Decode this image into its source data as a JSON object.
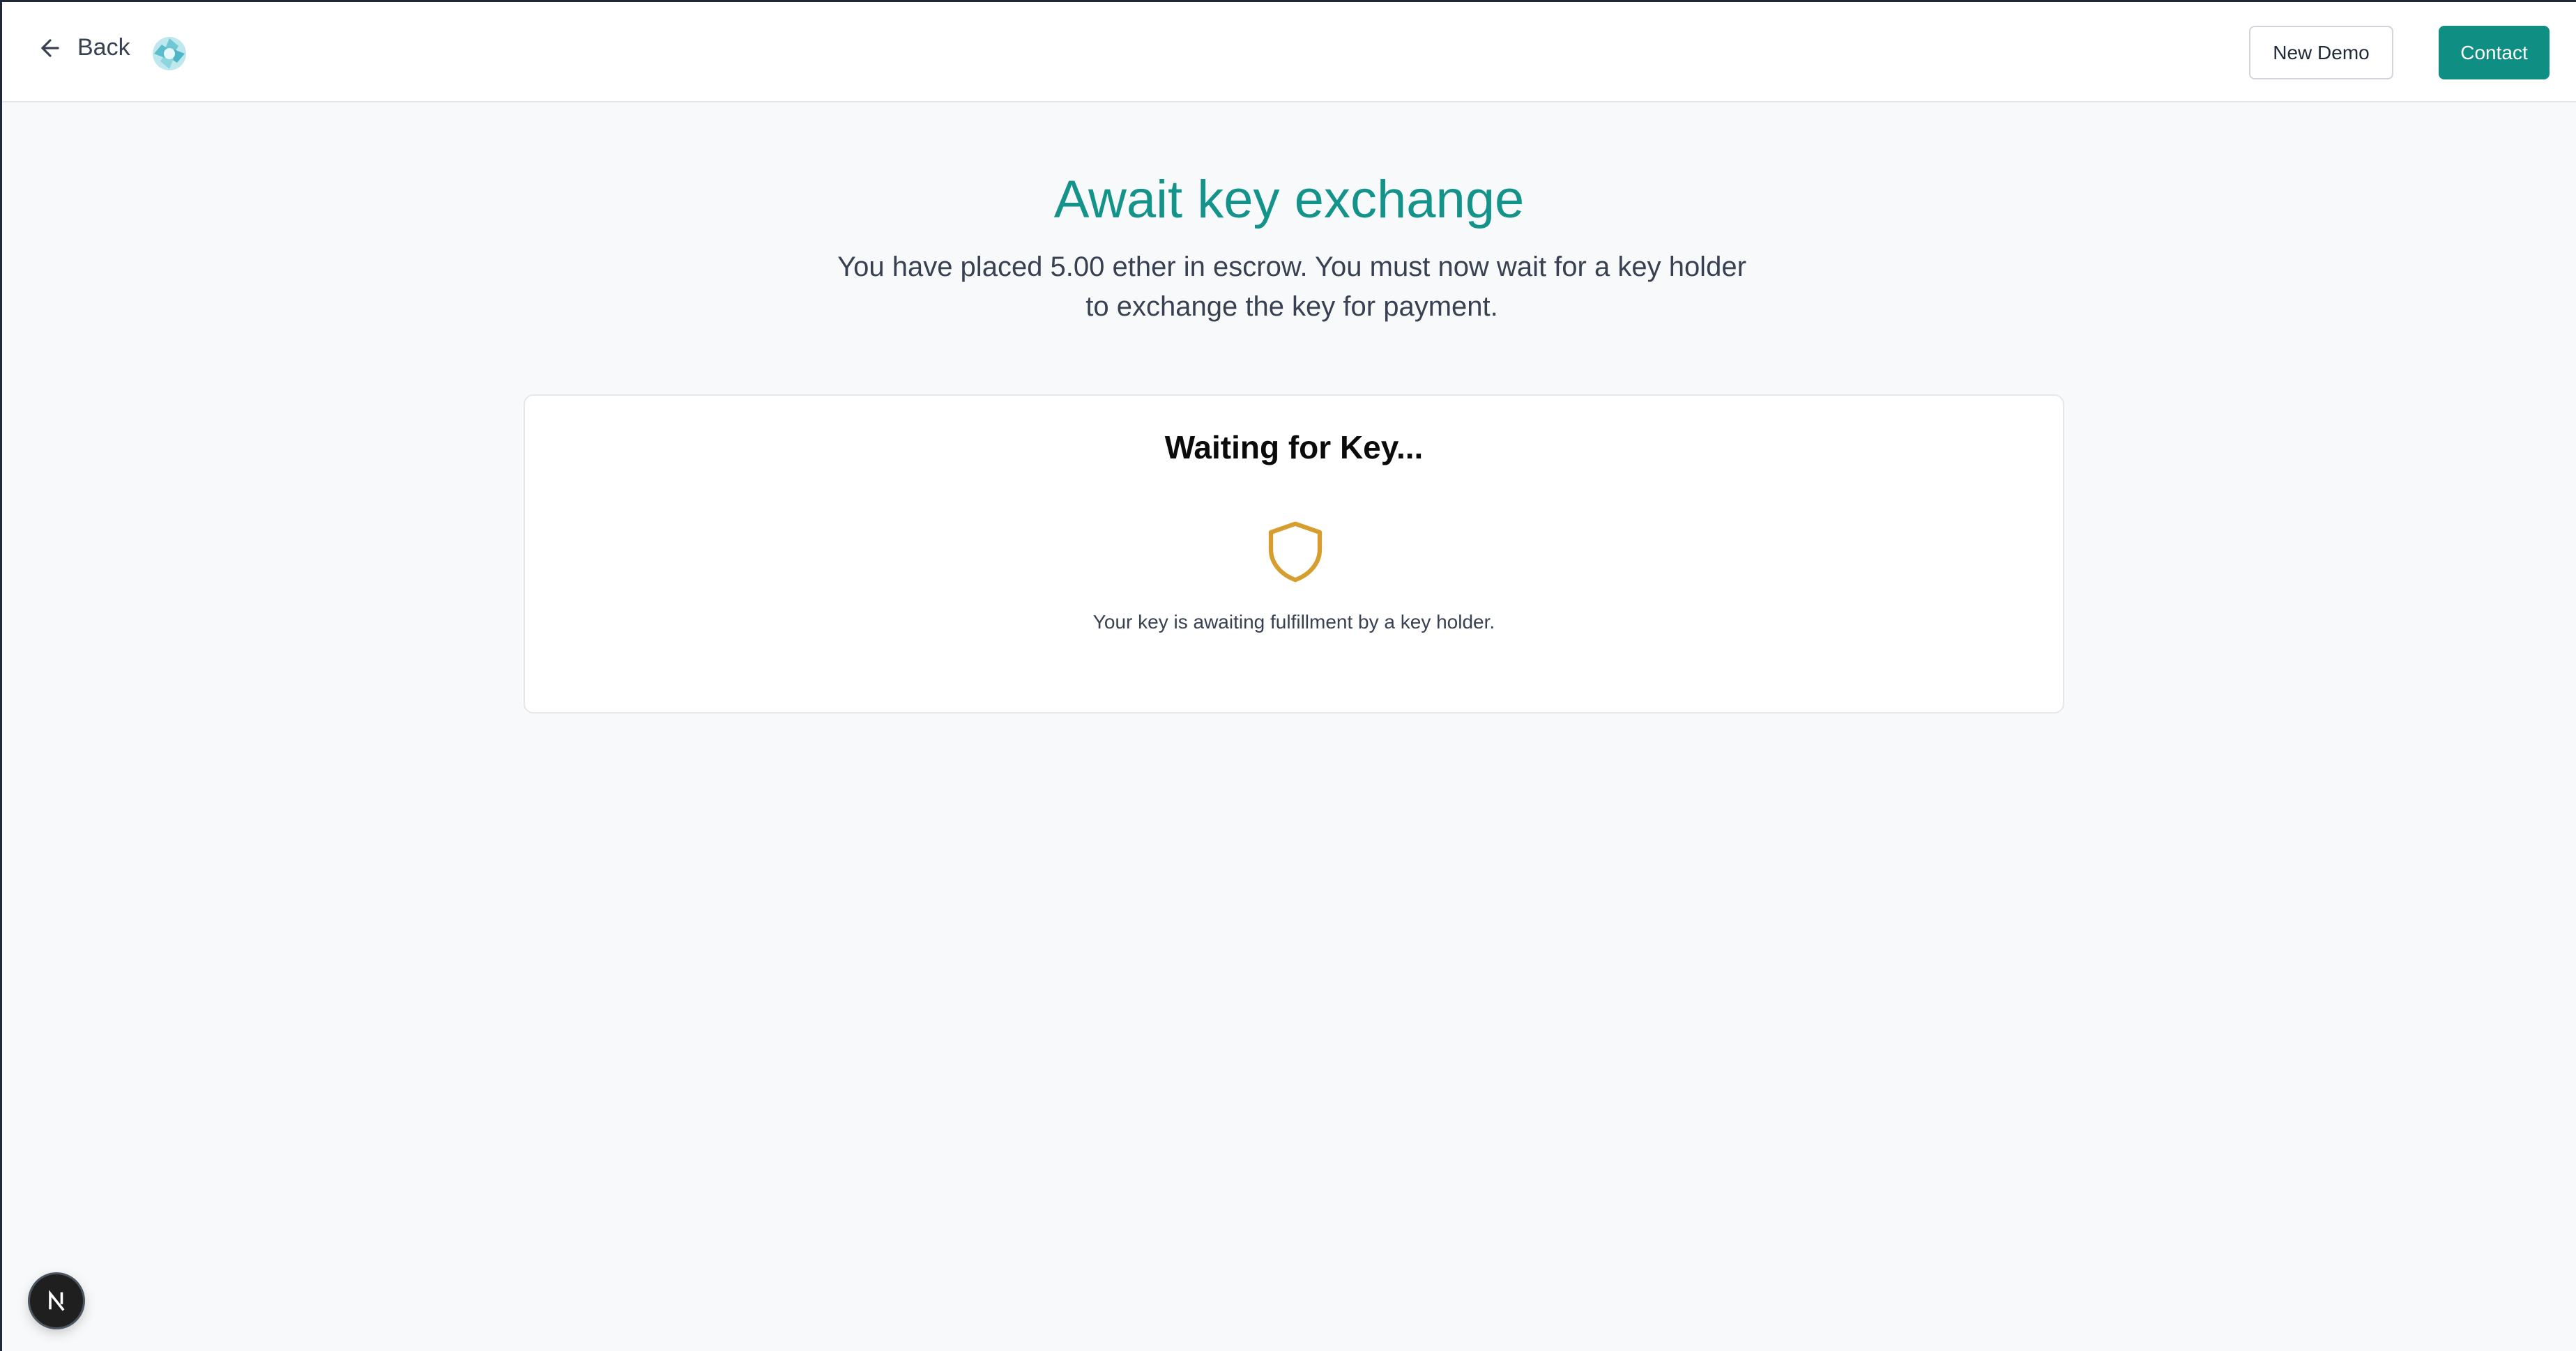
{
  "header": {
    "back_label": "Back",
    "new_demo_label": "New Demo",
    "contact_label": "Contact"
  },
  "main": {
    "title": "Await key exchange",
    "subtitle": "You have placed 5.00 ether in escrow. You must now wait for a key holder to exchange the key for payment."
  },
  "card": {
    "title": "Waiting for Key...",
    "message": "Your key is awaiting fulfillment by a key holder.",
    "icon": "shield-icon"
  },
  "badge": {
    "letter": "N",
    "icon": "nextjs-icon"
  },
  "colors": {
    "accent": "#0f8f83",
    "title": "#14938a",
    "shield": "#d69e2e",
    "background": "#f8f9fa"
  }
}
